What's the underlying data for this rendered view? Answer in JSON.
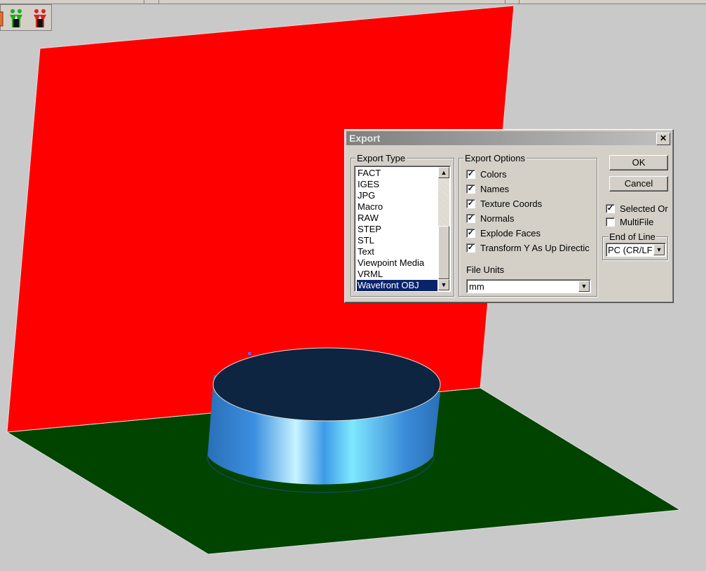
{
  "scene": {
    "colors": {
      "background": "#c9c9c9",
      "wall": "#ff0000",
      "floor": "#004400",
      "cylinder_top": "#0d2541",
      "cylinder_side": "#2d7fd0"
    }
  },
  "toolbar": {
    "icons": [
      "export-icon",
      "green-figure-icon",
      "red-figure-icon"
    ]
  },
  "dialog": {
    "title": "Export",
    "close_label": "✕",
    "export_type": {
      "label": "Export Type",
      "items": [
        "FACT",
        "IGES",
        "JPG",
        "Macro",
        "RAW",
        "STEP",
        "STL",
        "Text",
        "Viewpoint Media",
        "VRML",
        "Wavefront OBJ"
      ],
      "selected": "Wavefront OBJ"
    },
    "export_options": {
      "label": "Export Options",
      "options": [
        {
          "label": "Colors",
          "checked": true
        },
        {
          "label": "Names",
          "checked": true
        },
        {
          "label": "Texture Coords",
          "checked": true
        },
        {
          "label": "Normals",
          "checked": true
        },
        {
          "label": "Explode Faces",
          "checked": true
        },
        {
          "label": "Transform Y As Up Directic",
          "checked": true
        }
      ],
      "file_units_label": "File Units",
      "file_units_value": "mm"
    },
    "ok_label": "OK",
    "cancel_label": "Cancel",
    "selected_only": {
      "label": "Selected Or",
      "checked": true
    },
    "multifile": {
      "label": "MultiFile",
      "checked": false
    },
    "end_of_line": {
      "label": "End of Line",
      "value": "PC (CR/LF"
    }
  }
}
